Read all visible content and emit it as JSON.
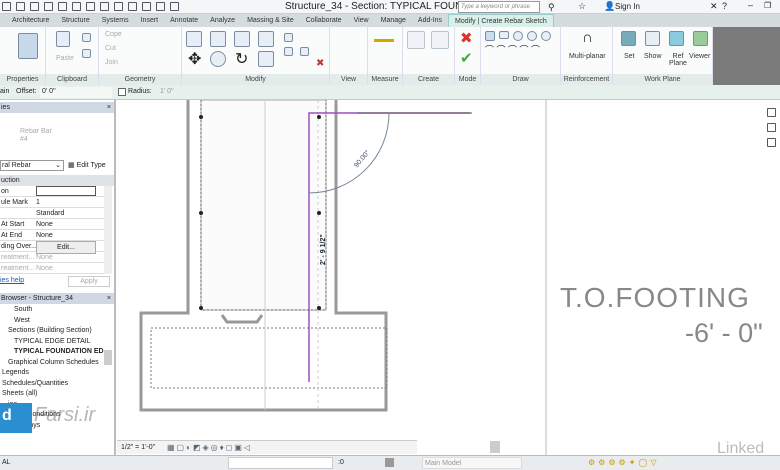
{
  "window": {
    "title": "Structure_34 - Section: TYPICAL FOUND...",
    "search_placeholder": "Type a keyword or phrase",
    "sign_in": "Sign In"
  },
  "tabs": [
    {
      "label": "Architecture"
    },
    {
      "label": "Structure"
    },
    {
      "label": "Systems"
    },
    {
      "label": "Insert"
    },
    {
      "label": "Annotate"
    },
    {
      "label": "Analyze"
    },
    {
      "label": "Massing & Site"
    },
    {
      "label": "Collaborate"
    },
    {
      "label": "View"
    },
    {
      "label": "Manage"
    },
    {
      "label": "Add-Ins"
    },
    {
      "label": "Modify | Create Rebar Sketch",
      "active": true
    }
  ],
  "ribbon": {
    "panels": {
      "properties": "Properties",
      "clipboard": "Clipboard",
      "geometry": "Geometry",
      "modify": "Modify",
      "view": "View",
      "measure": "Measure",
      "create": "Create",
      "mode": "Mode",
      "draw": "Draw",
      "reinforcement": "Reinforcement",
      "work_plane": "Work Plane"
    },
    "buttons": {
      "paste": "Paste",
      "cope": "Cope",
      "cut": "Cut",
      "join": "Join",
      "multi_planar": "Multi-planar",
      "set": "Set",
      "show": "Show",
      "ref_plane": "Ref Plane",
      "viewer": "Viewer"
    }
  },
  "options_bar": {
    "offset_label": "Offset:",
    "offset_value": "0' 0\"",
    "radius_label": "Radius:",
    "radius_value": "1' 0\"",
    "prefix": "ain"
  },
  "properties": {
    "title": "ies",
    "type_name": "Rebar Bar",
    "type_sub": "#4",
    "selector": "ral Rebar",
    "edit_type": "Edit Type",
    "section": "uction",
    "rows": [
      {
        "k": "on",
        "v": ""
      },
      {
        "k": "ule Mark",
        "v": "1"
      },
      {
        "k": "",
        "v": "Standard"
      },
      {
        "k": "At Start",
        "v": "None"
      },
      {
        "k": "At End",
        "v": "None"
      },
      {
        "k": "ding Over...",
        "v": "Edit..."
      },
      {
        "k": "reatment...",
        "v": "None"
      },
      {
        "k": "reatment...",
        "v": "None"
      }
    ],
    "help": "ies help",
    "apply": "Apply"
  },
  "browser": {
    "title": "Browser - Structure_34",
    "items": [
      {
        "label": "South",
        "indent": 2
      },
      {
        "label": "West",
        "indent": 2
      },
      {
        "label": "Sections (Building Section)",
        "indent": 1
      },
      {
        "label": "TYPICAL EDGE DETAIL",
        "indent": 2
      },
      {
        "label": "TYPICAL FOUNDATION ED",
        "indent": 2,
        "bold": true
      },
      {
        "label": "Graphical Column Schedules",
        "indent": 1
      },
      {
        "label": "Legends",
        "indent": 0
      },
      {
        "label": "Schedules/Quantities",
        "indent": 0
      },
      {
        "label": "Sheets (all)",
        "indent": 0
      },
      {
        "label": "ies",
        "indent": 1
      },
      {
        "label": "ndary Conditions",
        "indent": 1
      },
      {
        "label": "able Trays",
        "indent": 1
      }
    ]
  },
  "drawing": {
    "angle_label": "90.00°",
    "dimension_label": "2' - 9 1/2\"",
    "level_name": "T.O.FOOTING",
    "level_elev": "-6' - 0\"",
    "rebar_color": "#9b4fc0"
  },
  "view_control": {
    "scale": "1/2\" = 1'-0\""
  },
  "status": {
    "model": "Main Model",
    "left_text": "AL",
    "counter": ":0"
  },
  "watermarks": {
    "left": "Farsi.ir",
    "right": "Linked"
  }
}
